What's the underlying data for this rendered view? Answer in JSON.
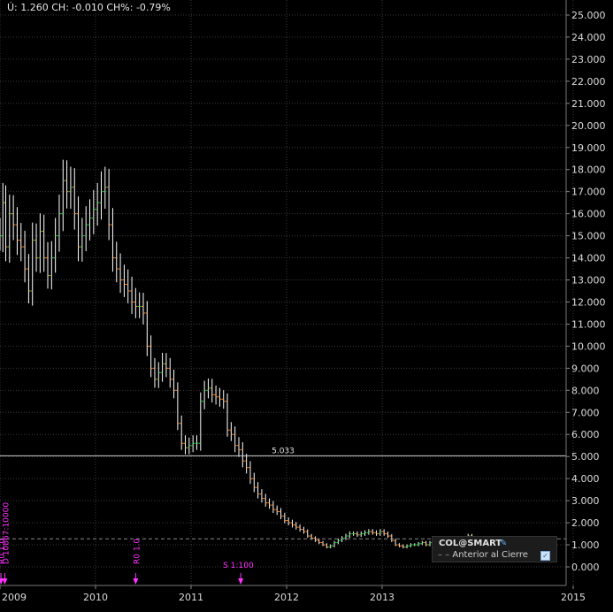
{
  "header": {
    "text": "Ú: 1.260 CH: -0.010 CH%: -0.79%"
  },
  "legend": {
    "symbol": "COL@SMART",
    "pin_icon": "pin-icon",
    "item_label": "Anterior al Cierre",
    "checkbox_icon": "check-icon"
  },
  "colors": {
    "background": "#000000",
    "grid": "#3a3a3a",
    "axis_text": "#dcdcdc",
    "up": "#2ecc40",
    "down": "#ff8a2a",
    "bar": "#ffffff",
    "event": "#ff33ff",
    "hline": "#cccccc"
  },
  "chart_data": {
    "type": "bar",
    "title": "",
    "xlabel": "",
    "ylabel": "",
    "ylim": [
      -0.3,
      25.3
    ],
    "yticks": [
      "25.000",
      "24.000",
      "23.000",
      "22.000",
      "21.000",
      "20.000",
      "19.000",
      "18.000",
      "17.000",
      "16.000",
      "15.000",
      "14.000",
      "13.000",
      "12.000",
      "11.000",
      "10.000",
      "9.000",
      "8.000",
      "7.000",
      "6.000",
      "5.000",
      "4.000",
      "3.000",
      "2.000",
      "1.000",
      "0.000"
    ],
    "ytick_values": [
      25,
      24,
      23,
      22,
      21,
      20,
      19,
      18,
      17,
      16,
      15,
      14,
      13,
      12,
      11,
      10,
      9,
      8,
      7,
      6,
      5,
      4,
      3,
      2,
      1,
      0
    ],
    "xlim": [
      2009.0,
      2016.0
    ],
    "xticks": [
      {
        "label": "2009",
        "x": 2009.0
      },
      {
        "label": "2010",
        "x": 2010.0
      },
      {
        "label": "2011",
        "x": 2011.0
      },
      {
        "label": "2012",
        "x": 2012.0
      },
      {
        "label": "2013",
        "x": 2013.0
      },
      {
        "label": "2015",
        "x": 2015.0
      }
    ],
    "series": [
      {
        "values": [
          [
            2009.0,
            15.0
          ],
          [
            2009.03,
            16.5
          ],
          [
            2009.06,
            14.5
          ],
          [
            2009.1,
            16.0
          ],
          [
            2009.14,
            15.5
          ],
          [
            2009.18,
            14.8
          ],
          [
            2009.22,
            14.5
          ],
          [
            2009.26,
            13.5
          ],
          [
            2009.3,
            12.5
          ],
          [
            2009.34,
            14.8
          ],
          [
            2009.38,
            14.0
          ],
          [
            2009.42,
            15.2
          ],
          [
            2009.46,
            14.0
          ],
          [
            2009.5,
            13.2
          ],
          [
            2009.54,
            14.0
          ],
          [
            2009.58,
            15.0
          ],
          [
            2009.62,
            16.0
          ],
          [
            2009.66,
            17.5
          ],
          [
            2009.7,
            17.0
          ],
          [
            2009.74,
            17.2
          ],
          [
            2009.78,
            16.0
          ],
          [
            2009.82,
            14.5
          ],
          [
            2009.86,
            15.0
          ],
          [
            2009.9,
            15.5
          ],
          [
            2009.94,
            15.8
          ],
          [
            2009.98,
            16.2
          ],
          [
            2010.02,
            16.5
          ],
          [
            2010.06,
            17.0
          ],
          [
            2010.1,
            17.2
          ],
          [
            2010.14,
            15.5
          ],
          [
            2010.18,
            14.0
          ],
          [
            2010.22,
            13.5
          ],
          [
            2010.26,
            13.0
          ],
          [
            2010.3,
            12.8
          ],
          [
            2010.34,
            12.5
          ],
          [
            2010.38,
            12.0
          ],
          [
            2010.42,
            11.8
          ],
          [
            2010.46,
            11.8
          ],
          [
            2010.5,
            11.5
          ],
          [
            2010.54,
            10.0
          ],
          [
            2010.58,
            9.0
          ],
          [
            2010.62,
            8.5
          ],
          [
            2010.66,
            8.8
          ],
          [
            2010.7,
            9.2
          ],
          [
            2010.74,
            9.0
          ],
          [
            2010.78,
            8.5
          ],
          [
            2010.82,
            8.0
          ],
          [
            2010.86,
            6.5
          ],
          [
            2010.9,
            5.6
          ],
          [
            2010.94,
            5.4
          ],
          [
            2010.98,
            5.5
          ],
          [
            2011.02,
            5.6
          ],
          [
            2011.06,
            5.6
          ],
          [
            2011.1,
            7.5
          ],
          [
            2011.14,
            8.0
          ],
          [
            2011.18,
            8.1
          ],
          [
            2011.22,
            7.8
          ],
          [
            2011.26,
            7.7
          ],
          [
            2011.3,
            7.6
          ],
          [
            2011.34,
            7.5
          ],
          [
            2011.38,
            6.2
          ],
          [
            2011.42,
            6.0
          ],
          [
            2011.46,
            5.5
          ],
          [
            2011.5,
            5.3
          ],
          [
            2011.54,
            4.8
          ],
          [
            2011.58,
            4.5
          ],
          [
            2011.62,
            4.0
          ],
          [
            2011.66,
            3.6
          ],
          [
            2011.7,
            3.3
          ],
          [
            2011.74,
            3.1
          ],
          [
            2011.78,
            2.9
          ],
          [
            2011.82,
            2.8
          ],
          [
            2011.86,
            2.6
          ],
          [
            2011.9,
            2.5
          ],
          [
            2011.94,
            2.3
          ],
          [
            2011.98,
            2.1
          ],
          [
            2012.02,
            2.0
          ],
          [
            2012.06,
            1.9
          ],
          [
            2012.1,
            1.8
          ],
          [
            2012.14,
            1.7
          ],
          [
            2012.18,
            1.6
          ],
          [
            2012.22,
            1.4
          ],
          [
            2012.26,
            1.3
          ],
          [
            2012.3,
            1.2
          ],
          [
            2012.34,
            1.1
          ],
          [
            2012.38,
            1.0
          ],
          [
            2012.42,
            0.9
          ],
          [
            2012.46,
            0.95
          ],
          [
            2012.5,
            1.1
          ],
          [
            2012.54,
            1.2
          ],
          [
            2012.58,
            1.3
          ],
          [
            2012.62,
            1.4
          ],
          [
            2012.66,
            1.5
          ],
          [
            2012.7,
            1.5
          ],
          [
            2012.74,
            1.45
          ],
          [
            2012.78,
            1.5
          ],
          [
            2012.82,
            1.55
          ],
          [
            2012.86,
            1.6
          ],
          [
            2012.9,
            1.55
          ],
          [
            2012.94,
            1.5
          ],
          [
            2012.98,
            1.6
          ],
          [
            2013.02,
            1.5
          ],
          [
            2013.06,
            1.4
          ],
          [
            2013.1,
            1.2
          ],
          [
            2013.14,
            1.0
          ],
          [
            2013.18,
            0.95
          ],
          [
            2013.22,
            0.9
          ],
          [
            2013.26,
            0.95
          ],
          [
            2013.3,
            1.0
          ],
          [
            2013.34,
            1.0
          ],
          [
            2013.38,
            1.05
          ],
          [
            2013.42,
            1.1
          ],
          [
            2013.46,
            1.0
          ],
          [
            2013.5,
            1.1
          ],
          [
            2013.54,
            1.05
          ],
          [
            2013.58,
            1.1
          ],
          [
            2013.62,
            1.15
          ],
          [
            2013.66,
            1.1
          ],
          [
            2013.7,
            1.15
          ],
          [
            2013.74,
            1.2
          ],
          [
            2013.78,
            1.15
          ],
          [
            2013.82,
            1.2
          ],
          [
            2013.86,
            1.3
          ],
          [
            2013.9,
            1.4
          ],
          [
            2013.94,
            1.3
          ],
          [
            2013.98,
            1.26
          ]
        ]
      }
    ],
    "reference_line": {
      "value": 5.033,
      "label": "5.033"
    },
    "previous_close": 1.27,
    "events": [
      {
        "x": 2009.01,
        "label": "R0 1.0"
      },
      {
        "x": 2009.05,
        "label": "D 10867:10000"
      },
      {
        "x": 2010.42,
        "label": "R0 1.0"
      },
      {
        "x": 2011.52,
        "label": "S 1:100"
      }
    ],
    "grid": true,
    "legend_position": "bottom-right"
  }
}
